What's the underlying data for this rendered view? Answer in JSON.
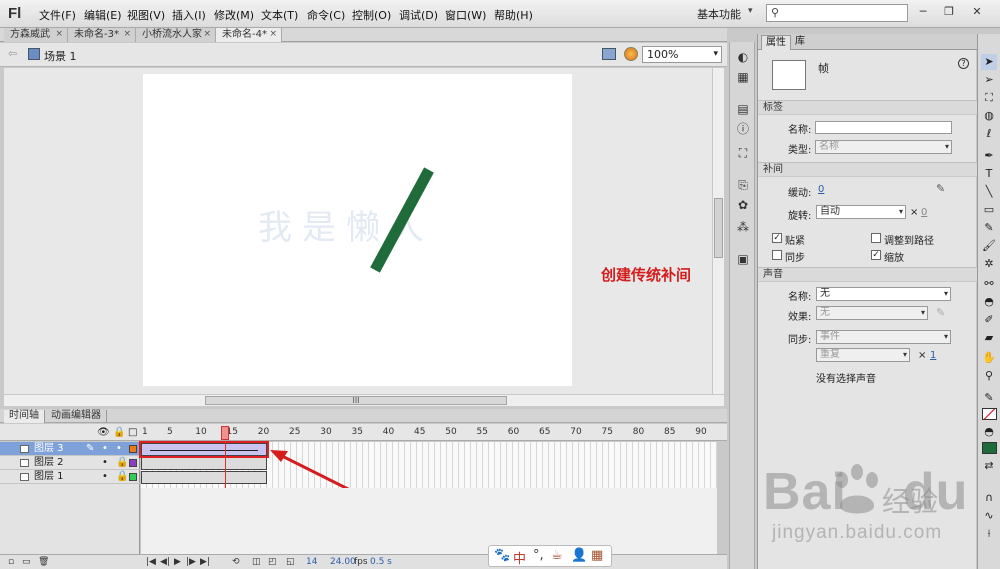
{
  "app": {
    "logo": "Fl"
  },
  "menu": [
    "文件(F)",
    "编辑(E)",
    "视图(V)",
    "插入(I)",
    "修改(M)",
    "文本(T)",
    "命令(C)",
    "控制(O)",
    "调试(D)",
    "窗口(W)",
    "帮助(H)"
  ],
  "workspace": {
    "label": "基本功能",
    "arrow": "▾"
  },
  "search": {
    "placeholder": "",
    "icon": "⚲"
  },
  "window_buttons": {
    "minimize": "─",
    "restore": "❐",
    "close": "✕"
  },
  "doc_tabs": [
    {
      "label": "方森威武",
      "close": "×"
    },
    {
      "label": "未命名-3*",
      "close": "×"
    },
    {
      "label": "小桥流水人家",
      "close": "×"
    },
    {
      "label": "未命名-4*",
      "close": "×"
    }
  ],
  "edit_bar": {
    "back": "⇦",
    "scene": "场景 1",
    "zoom": "100%",
    "zoom_arrow": "▾"
  },
  "stage": {
    "text": "我是懒人",
    "line_color": "#1f6b3a"
  },
  "annotation": "创建传统补间",
  "hscroll_grip": "III",
  "timeline": {
    "tabs": [
      "时间轴",
      "动画编辑器"
    ],
    "header_icons": {
      "eye": "👁",
      "lock": "🔒",
      "outline": "□"
    },
    "ruler": [
      "1",
      "5",
      "10",
      "15",
      "20",
      "25",
      "30",
      "35",
      "40",
      "45",
      "50",
      "55",
      "60",
      "65",
      "70",
      "75",
      "80",
      "85",
      "90"
    ],
    "layers": [
      {
        "name": "图层 3",
        "color": "#e87a1a",
        "selected": true,
        "pencil": "✎",
        "dot": "•",
        "lock": "•"
      },
      {
        "name": "图层 2",
        "color": "#8a3fc4",
        "selected": false,
        "pencil": "",
        "dot": "•",
        "lock": "🔒"
      },
      {
        "name": "图层 1",
        "color": "#33cc55",
        "selected": false,
        "pencil": "",
        "dot": "•",
        "lock": "🔒"
      }
    ],
    "footer": {
      "current_frame": "14",
      "fps": "24.00",
      "fps_unit": "fps",
      "time": "0.5 s"
    }
  },
  "ime": {
    "paw": "🐾",
    "lang": "中",
    "punct": "°,",
    "cup": "☕",
    "person": "👤",
    "grid": "▦"
  },
  "properties": {
    "tabs": [
      "属性",
      "库"
    ],
    "type_label": "帧",
    "sections": {
      "label": "标签",
      "tween": "补间",
      "sound": "声音"
    },
    "label_section": {
      "name_label": "名称:",
      "name_value": "",
      "type_label": "类型:",
      "type_value": "名称"
    },
    "tween_section": {
      "ease_label": "缓动:",
      "ease_value": "0",
      "rotate_label": "旋转:",
      "rotate_value": "自动",
      "rotate_times_prefix": "×",
      "rotate_times": "0",
      "snap": "贴紧",
      "snap_checked": true,
      "orient": "调整到路径",
      "orient_checked": false,
      "sync": "同步",
      "sync_checked": false,
      "scale": "缩放",
      "scale_checked": true
    },
    "sound_section": {
      "name_label": "名称:",
      "name_value": "无",
      "effect_label": "效果:",
      "effect_value": "无",
      "sync_label": "同步:",
      "sync_value": "事件",
      "repeat_value": "重复",
      "repeat_times_prefix": "×",
      "repeat_times": "1",
      "status": "没有选择声音"
    }
  },
  "watermark": {
    "brand": "Bai",
    "brand2": "du",
    "cn": "经验",
    "url": "jingyan.baidu.com"
  }
}
